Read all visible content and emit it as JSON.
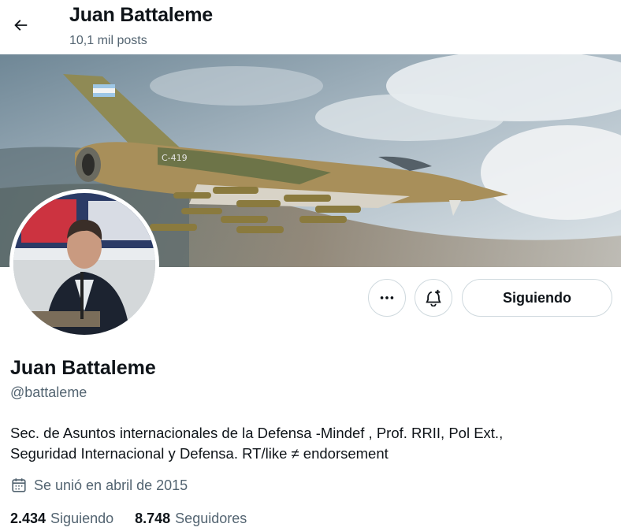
{
  "header": {
    "back_icon": "arrow-left-icon",
    "title": "Juan Battaleme",
    "posts_count": "10,1 mil posts"
  },
  "banner": {
    "description_icon": "fighter-jet-banner-image",
    "tail_marking": "C-419"
  },
  "actions": {
    "more_icon": "more-dots-icon",
    "notify_icon": "bell-plus-icon",
    "follow_label": "Siguiendo"
  },
  "profile": {
    "name": "Juan Battaleme",
    "handle": "@battaleme",
    "bio_line1": "Sec. de Asuntos internacionales de la Defensa -Mindef , Prof. RRII, Pol Ext.,",
    "bio_line2": "Seguridad Internacional y Defensa.  RT/like ≠ endorsement",
    "joined_icon": "calendar-icon",
    "joined": "Se unió en abril de 2015"
  },
  "stats": {
    "following_count": "2.434",
    "following_label": "Siguiendo",
    "followers_count": "8.748",
    "followers_label": "Seguidores"
  },
  "colors": {
    "text": "#0f1419",
    "secondary_text": "#536471",
    "border": "#cfd9de"
  }
}
